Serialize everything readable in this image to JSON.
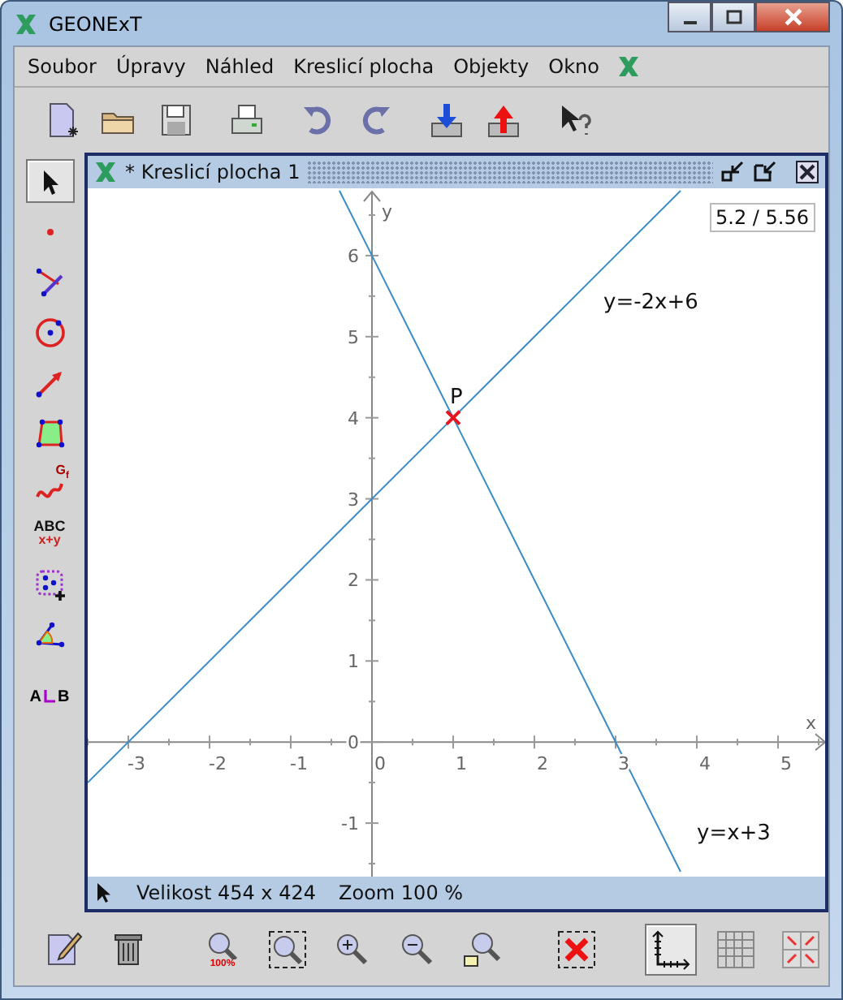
{
  "window": {
    "title": "GEONExT"
  },
  "menu": [
    {
      "label": "Soubor"
    },
    {
      "label": "Úpravy"
    },
    {
      "label": "Náhled"
    },
    {
      "label": "Kreslicí plocha"
    },
    {
      "label": "Objekty"
    },
    {
      "label": "Okno"
    }
  ],
  "toolbar": {
    "groups": [
      [
        {
          "kind": "new"
        },
        {
          "kind": "open"
        },
        {
          "kind": "save"
        }
      ],
      [
        {
          "kind": "print"
        }
      ],
      [
        {
          "kind": "undo"
        },
        {
          "kind": "redo"
        }
      ],
      [
        {
          "kind": "import"
        },
        {
          "kind": "export"
        }
      ],
      [
        {
          "kind": "help"
        }
      ]
    ]
  },
  "tools": {
    "groups": [
      [
        {
          "kind": "pointer",
          "selected": true
        },
        {
          "kind": "point",
          "selected": false
        },
        {
          "kind": "perpendicular",
          "selected": false
        },
        {
          "kind": "circle",
          "selected": false
        },
        {
          "kind": "vector",
          "selected": false
        },
        {
          "kind": "polygon",
          "selected": false
        },
        {
          "kind": "curve",
          "selected": false,
          "label": "G",
          "sublabel": "f"
        },
        {
          "kind": "text",
          "selected": false,
          "label": "ABC",
          "sublabel": "x+y"
        },
        {
          "kind": "group",
          "selected": false
        },
        {
          "kind": "angle",
          "selected": false
        }
      ],
      [
        {
          "kind": "transfer",
          "selected": false,
          "label": "A",
          "sublabel": "B"
        }
      ]
    ]
  },
  "board": {
    "title": "* Kreslicí plocha 1",
    "coordinates": "5.2 / 5.56",
    "chart_data": {
      "type": "line",
      "xlabel": "x",
      "ylabel": "y",
      "xlim": [
        -3.5,
        5.58
      ],
      "ylim": [
        -1.66,
        6.83
      ],
      "xticks": [
        -3,
        -2,
        -1,
        0,
        1,
        2,
        3,
        4,
        5
      ],
      "yticks": [
        -1,
        0,
        1,
        2,
        3,
        4,
        5,
        6
      ],
      "x": [
        -3.5,
        -0.4,
        0,
        1,
        2,
        3,
        3.8
      ],
      "series": [
        {
          "color": "#3a8cc6",
          "values": [
            -0.5,
            2.6,
            3,
            4,
            5,
            6,
            6.8
          ]
        },
        {
          "color": "#3a8cc6",
          "values": [
            null,
            6.8,
            6,
            4,
            2,
            0,
            -1.6
          ]
        }
      ],
      "annotations": [
        {
          "text": "P",
          "x": 1,
          "y": 4
        },
        "y=-2x+6",
        "y=x+3"
      ]
    },
    "status": [
      {
        "text": "Velikost 454 x 424"
      },
      {
        "text": "Zoom 100 %"
      }
    ]
  },
  "bottom_toolbar": {
    "groups": [
      [
        {
          "kind": "edit",
          "selected": false
        },
        {
          "kind": "delete",
          "selected": false
        }
      ],
      [
        {
          "kind": "zoom-reset",
          "selected": false,
          "label": "100%"
        },
        {
          "kind": "zoom-fit",
          "selected": false
        },
        {
          "kind": "zoom-in",
          "selected": false
        },
        {
          "kind": "zoom-out",
          "selected": false
        },
        {
          "kind": "zoom-select",
          "selected": false
        }
      ],
      [
        {
          "kind": "delete-all",
          "selected": false
        }
      ],
      [
        {
          "kind": "axes",
          "selected": true
        },
        {
          "kind": "grid",
          "selected": false
        },
        {
          "kind": "snap",
          "selected": false
        }
      ]
    ]
  }
}
